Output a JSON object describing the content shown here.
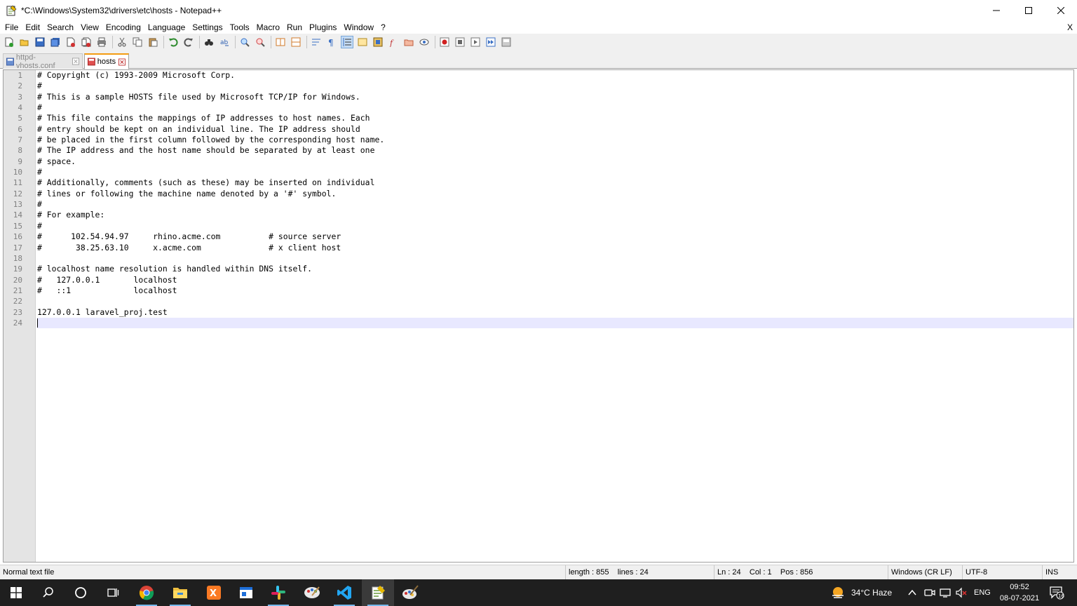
{
  "window": {
    "title": "*C:\\Windows\\System32\\drivers\\etc\\hosts - Notepad++",
    "minimize_icon": "minimize-icon",
    "maximize_icon": "maximize-icon",
    "close_icon": "close-icon"
  },
  "menu": {
    "items": [
      "File",
      "Edit",
      "Search",
      "View",
      "Encoding",
      "Language",
      "Settings",
      "Tools",
      "Macro",
      "Run",
      "Plugins",
      "Window",
      "?"
    ],
    "close_label": "X"
  },
  "tabs": [
    {
      "label": "httpd-vhosts.conf",
      "active": false
    },
    {
      "label": "hosts",
      "active": true
    }
  ],
  "editor": {
    "line_numbers": [
      "1",
      "2",
      "3",
      "4",
      "5",
      "6",
      "7",
      "8",
      "9",
      "10",
      "11",
      "12",
      "13",
      "14",
      "15",
      "16",
      "17",
      "18",
      "19",
      "20",
      "21",
      "22",
      "23",
      "24"
    ],
    "lines": [
      "# Copyright (c) 1993-2009 Microsoft Corp.",
      "#",
      "# This is a sample HOSTS file used by Microsoft TCP/IP for Windows.",
      "#",
      "# This file contains the mappings of IP addresses to host names. Each",
      "# entry should be kept on an individual line. The IP address should",
      "# be placed in the first column followed by the corresponding host name.",
      "# The IP address and the host name should be separated by at least one",
      "# space.",
      "#",
      "# Additionally, comments (such as these) may be inserted on individual",
      "# lines or following the machine name denoted by a '#' symbol.",
      "#",
      "# For example:",
      "#",
      "#      102.54.94.97     rhino.acme.com          # source server",
      "#       38.25.63.10     x.acme.com              # x client host",
      "",
      "# localhost name resolution is handled within DNS itself.",
      "#   127.0.0.1       localhost",
      "#   ::1             localhost",
      "",
      "127.0.0.1 laravel_proj.test",
      ""
    ],
    "current_line": 24
  },
  "status": {
    "file_type": "Normal text file",
    "length": "length : 855",
    "lines": "lines : 24",
    "ln": "Ln : 24",
    "col": "Col : 1",
    "pos": "Pos : 856",
    "eol": "Windows (CR LF)",
    "encoding": "UTF-8",
    "mode": "INS"
  },
  "taskbar": {
    "weather": "34°C  Haze",
    "language": "ENG",
    "time": "09:52",
    "date": "08-07-2021",
    "notifications": "16"
  }
}
